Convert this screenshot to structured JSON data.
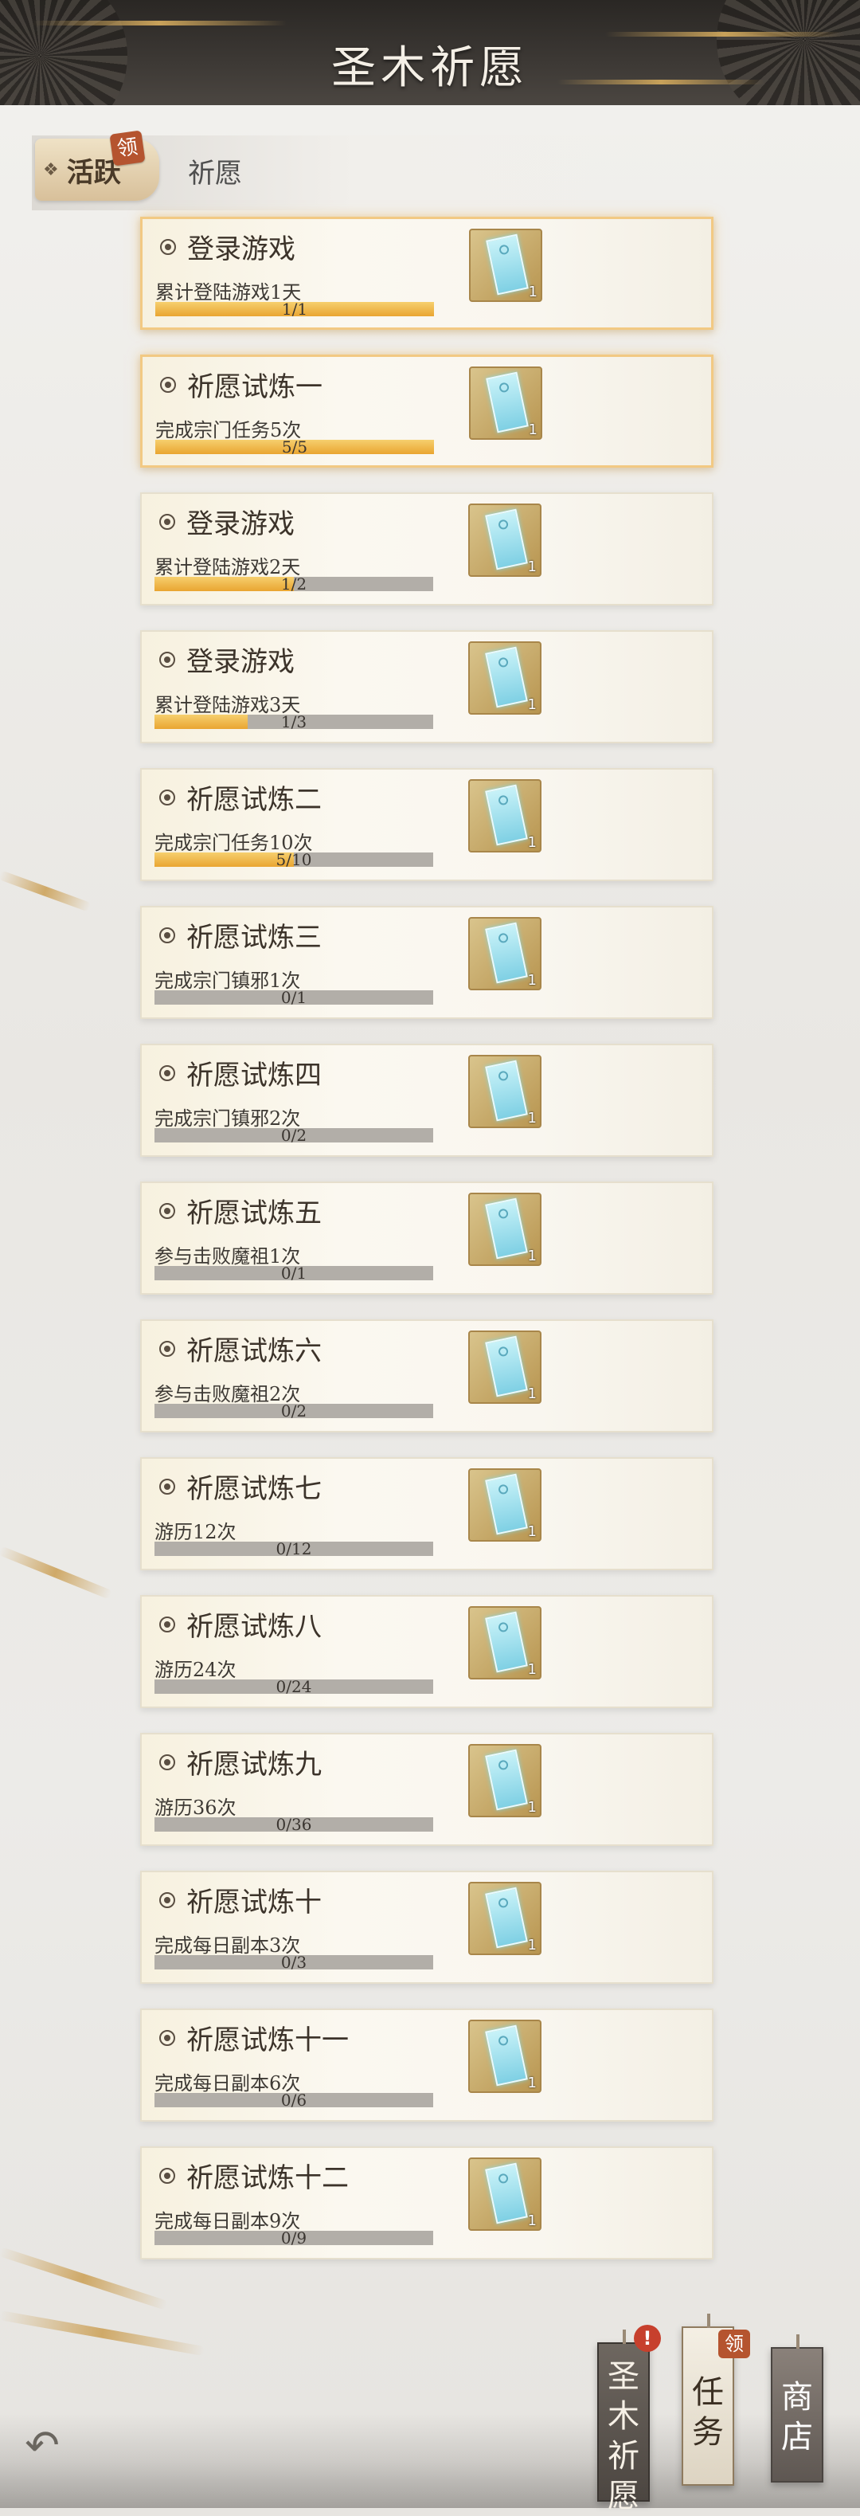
{
  "header": {
    "title": "圣木祈愿"
  },
  "tabs": {
    "active_label": "活跃",
    "active_badge": "领",
    "other_label": "祈愿"
  },
  "tasks": [
    {
      "title": "登录游戏",
      "desc": "累计登陆游戏1天",
      "progress": "1/1",
      "fraction": 1.0,
      "reward_qty": "1",
      "claimable": true
    },
    {
      "title": "祈愿试炼一",
      "desc": "完成宗门任务5次",
      "progress": "5/5",
      "fraction": 1.0,
      "reward_qty": "1",
      "claimable": true
    },
    {
      "title": "登录游戏",
      "desc": "累计登陆游戏2天",
      "progress": "1/2",
      "fraction": 0.5,
      "reward_qty": "1",
      "claimable": false
    },
    {
      "title": "登录游戏",
      "desc": "累计登陆游戏3天",
      "progress": "1/3",
      "fraction": 0.333,
      "reward_qty": "1",
      "claimable": false
    },
    {
      "title": "祈愿试炼二",
      "desc": "完成宗门任务10次",
      "progress": "5/10",
      "fraction": 0.5,
      "reward_qty": "1",
      "claimable": false
    },
    {
      "title": "祈愿试炼三",
      "desc": "完成宗门镇邪1次",
      "progress": "0/1",
      "fraction": 0,
      "reward_qty": "1",
      "claimable": false
    },
    {
      "title": "祈愿试炼四",
      "desc": "完成宗门镇邪2次",
      "progress": "0/2",
      "fraction": 0,
      "reward_qty": "1",
      "claimable": false
    },
    {
      "title": "祈愿试炼五",
      "desc": "参与击败魔祖1次",
      "progress": "0/1",
      "fraction": 0,
      "reward_qty": "1",
      "claimable": false
    },
    {
      "title": "祈愿试炼六",
      "desc": "参与击败魔祖2次",
      "progress": "0/2",
      "fraction": 0,
      "reward_qty": "1",
      "claimable": false
    },
    {
      "title": "祈愿试炼七",
      "desc": "游历12次",
      "progress": "0/12",
      "fraction": 0,
      "reward_qty": "1",
      "claimable": false
    },
    {
      "title": "祈愿试炼八",
      "desc": "游历24次",
      "progress": "0/24",
      "fraction": 0,
      "reward_qty": "1",
      "claimable": false
    },
    {
      "title": "祈愿试炼九",
      "desc": "游历36次",
      "progress": "0/36",
      "fraction": 0,
      "reward_qty": "1",
      "claimable": false
    },
    {
      "title": "祈愿试炼十",
      "desc": "完成每日副本3次",
      "progress": "0/3",
      "fraction": 0,
      "reward_qty": "1",
      "claimable": false
    },
    {
      "title": "祈愿试炼十一",
      "desc": "完成每日副本6次",
      "progress": "0/6",
      "fraction": 0,
      "reward_qty": "1",
      "claimable": false
    },
    {
      "title": "祈愿试炼十二",
      "desc": "完成每日副本9次",
      "progress": "0/9",
      "fraction": 0,
      "reward_qty": "1",
      "claimable": false
    }
  ],
  "bottom_nav": {
    "wish": {
      "label_chars": [
        "圣",
        "木",
        "祈",
        "愿"
      ],
      "badge": "!"
    },
    "task": {
      "label_chars": [
        "任",
        "务"
      ],
      "badge": "领"
    },
    "shop": {
      "label_chars": [
        "商",
        "店"
      ]
    }
  },
  "icons": {
    "back": "back-arrow-icon",
    "reward": "talisman-icon",
    "tab": "diamond-icon"
  },
  "colors": {
    "progress_fill": "#e9a531",
    "progress_track": "#b2aea8",
    "badge": "#b5542f",
    "alert": "#c7402d"
  }
}
